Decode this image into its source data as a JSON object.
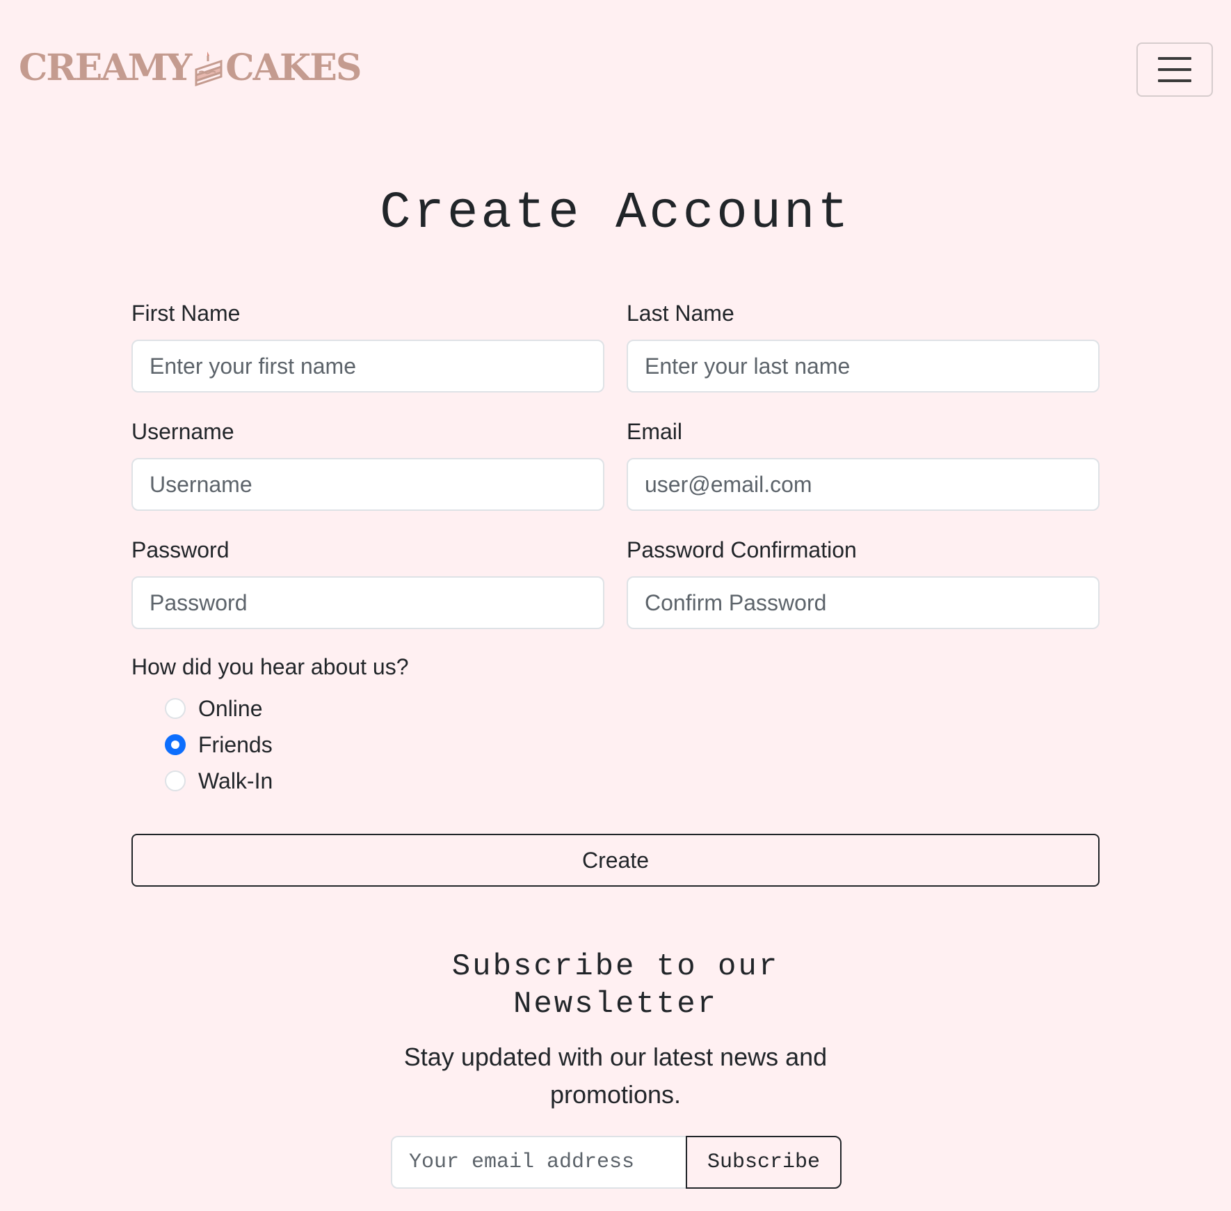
{
  "brand": {
    "name_left": "CREAMY",
    "name_right": "CAKES",
    "icon": "cake-slice-icon",
    "color": "#c49b8f"
  },
  "navbar": {
    "menu_icon": "hamburger-menu-icon"
  },
  "page": {
    "title": "Create Account",
    "background": "#fff0f2"
  },
  "form": {
    "first_name": {
      "label": "First Name",
      "placeholder": "Enter your first name",
      "value": ""
    },
    "last_name": {
      "label": "Last Name",
      "placeholder": "Enter your last name",
      "value": ""
    },
    "username": {
      "label": "Username",
      "placeholder": "Username",
      "value": ""
    },
    "email": {
      "label": "Email",
      "placeholder": "user@email.com",
      "value": ""
    },
    "password": {
      "label": "Password",
      "placeholder": "Password",
      "value": ""
    },
    "password_confirmation": {
      "label": "Password Confirmation",
      "placeholder": "Confirm Password",
      "value": ""
    },
    "referral": {
      "label": "How did you hear about us?",
      "options": [
        {
          "label": "Online",
          "checked": false
        },
        {
          "label": "Friends",
          "checked": true
        },
        {
          "label": "Walk-In",
          "checked": false
        }
      ],
      "selected": "Friends",
      "accent_color": "#0d6efd"
    },
    "submit_label": "Create"
  },
  "newsletter": {
    "title": "Subscribe to our Newsletter",
    "text": "Stay updated with our latest news and promotions.",
    "email_placeholder": "Your email address",
    "button_label": "Subscribe"
  }
}
